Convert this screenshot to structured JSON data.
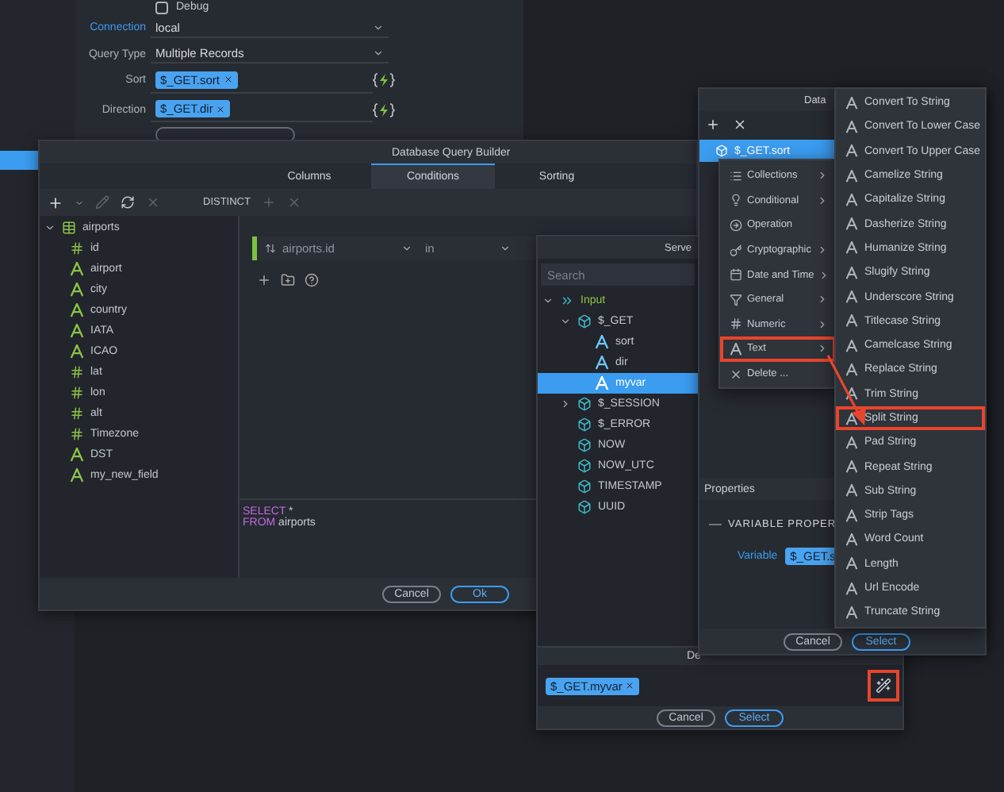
{
  "app_form": {
    "debug": {
      "label": "Debug",
      "checked": false
    },
    "fields": [
      {
        "label": "Connection",
        "kind": "select",
        "value": "local",
        "focused": true
      },
      {
        "label": "Query Type",
        "kind": "select",
        "value": "Multiple Records",
        "focused": false
      },
      {
        "label": "Sort",
        "kind": "tag",
        "value": "$_GET.sort",
        "focused": false
      },
      {
        "label": "Direction",
        "kind": "tag",
        "value": "$_GET.dir",
        "focused": false
      }
    ]
  },
  "query_builder": {
    "title": "Database Query Builder",
    "tabs": [
      {
        "label": "Columns",
        "selected": false
      },
      {
        "label": "Conditions",
        "selected": true
      },
      {
        "label": "Sorting",
        "selected": false
      }
    ],
    "distinct": "DISTINCT",
    "table": {
      "name": "airports",
      "expanded": true,
      "fields": [
        {
          "name": "id",
          "kind": "number"
        },
        {
          "name": "airport",
          "kind": "text"
        },
        {
          "name": "city",
          "kind": "text"
        },
        {
          "name": "country",
          "kind": "text"
        },
        {
          "name": "IATA",
          "kind": "text"
        },
        {
          "name": "ICAO",
          "kind": "text"
        },
        {
          "name": "lat",
          "kind": "number"
        },
        {
          "name": "lon",
          "kind": "number"
        },
        {
          "name": "alt",
          "kind": "number"
        },
        {
          "name": "Timezone",
          "kind": "number"
        },
        {
          "name": "DST",
          "kind": "text"
        },
        {
          "name": "my_new_field",
          "kind": "text"
        }
      ]
    },
    "condition": {
      "field": "airports.id",
      "operator": "in"
    },
    "sql": [
      {
        "keyword": "SELECT",
        "text": " *"
      },
      {
        "keyword": "FROM",
        "text": " airports"
      }
    ],
    "buttons": [
      {
        "label": "Cancel",
        "primary": false
      },
      {
        "label": "Ok",
        "primary": true
      }
    ]
  },
  "server_data": {
    "title": "Serve",
    "search": {
      "placeholder": "Search"
    },
    "tree": [
      {
        "label": "Input",
        "kind": "group",
        "expanded": true,
        "selected": false,
        "children": [
          {
            "label": "$_GET",
            "kind": "object",
            "expanded": true,
            "selected": false,
            "children": [
              {
                "label": "sort",
                "kind": "text",
                "selected": false
              },
              {
                "label": "dir",
                "kind": "text",
                "selected": false
              },
              {
                "label": "myvar",
                "kind": "text",
                "selected": true
              }
            ]
          },
          {
            "label": "$_SESSION",
            "kind": "object",
            "expanded": false,
            "selected": false
          },
          {
            "label": "$_ERROR",
            "kind": "object",
            "selected": false
          },
          {
            "label": "NOW",
            "kind": "object",
            "selected": false
          },
          {
            "label": "NOW_UTC",
            "kind": "object",
            "selected": false
          },
          {
            "label": "TIMESTAMP",
            "kind": "object",
            "selected": false
          },
          {
            "label": "UUID",
            "kind": "object",
            "selected": false
          }
        ]
      }
    ],
    "expression": {
      "title": "De",
      "tag": "$_GET.myvar",
      "wand_highlighted": true
    },
    "buttons": [
      {
        "label": "Cancel",
        "primary": false
      },
      {
        "label": "Select",
        "primary": true
      }
    ]
  },
  "data_picker": {
    "title": "Data",
    "selected_item": "$_GET.sort",
    "properties": {
      "title": "Properties",
      "section": "VARIABLE PROPER",
      "variable_label": "Variable",
      "variable_value": "$_GET.s"
    },
    "buttons": [
      {
        "label": "Cancel",
        "primary": false
      },
      {
        "label": "Select",
        "primary": true
      }
    ]
  },
  "context_menu": {
    "items": [
      {
        "label": "Collections",
        "submenu": true,
        "highlighted": false
      },
      {
        "label": "Conditional",
        "submenu": true,
        "highlighted": false
      },
      {
        "label": "Operation",
        "submenu": false,
        "highlighted": false
      },
      {
        "label": "Cryptographic",
        "submenu": true,
        "highlighted": false
      },
      {
        "label": "Date and Time",
        "submenu": true,
        "highlighted": false
      },
      {
        "label": "General",
        "submenu": true,
        "highlighted": false
      },
      {
        "label": "Numeric",
        "submenu": true,
        "highlighted": false
      },
      {
        "label": "Text",
        "submenu": true,
        "highlighted": true
      },
      {
        "label": "Delete ...",
        "submenu": false,
        "highlighted": false
      }
    ]
  },
  "submenu": {
    "items": [
      {
        "label": "Convert To String",
        "highlighted": false
      },
      {
        "label": "Convert To Lower Case",
        "highlighted": false
      },
      {
        "label": "Convert To Upper Case",
        "highlighted": false
      },
      {
        "label": "Camelize String",
        "highlighted": false
      },
      {
        "label": "Capitalize String",
        "highlighted": false
      },
      {
        "label": "Dasherize String",
        "highlighted": false
      },
      {
        "label": "Humanize String",
        "highlighted": false
      },
      {
        "label": "Slugify String",
        "highlighted": false
      },
      {
        "label": "Underscore String",
        "highlighted": false
      },
      {
        "label": "Titlecase String",
        "highlighted": false
      },
      {
        "label": "Camelcase String",
        "highlighted": false
      },
      {
        "label": "Replace String",
        "highlighted": false
      },
      {
        "label": "Trim String",
        "highlighted": false
      },
      {
        "label": "Split String",
        "highlighted": true
      },
      {
        "label": "Pad String",
        "highlighted": false
      },
      {
        "label": "Repeat String",
        "highlighted": false
      },
      {
        "label": "Sub String",
        "highlighted": false
      },
      {
        "label": "Strip Tags",
        "highlighted": false
      },
      {
        "label": "Word Count",
        "highlighted": false
      },
      {
        "label": "Length",
        "highlighted": false
      },
      {
        "label": "Url Encode",
        "highlighted": false
      },
      {
        "label": "Truncate String",
        "highlighted": false
      }
    ]
  }
}
